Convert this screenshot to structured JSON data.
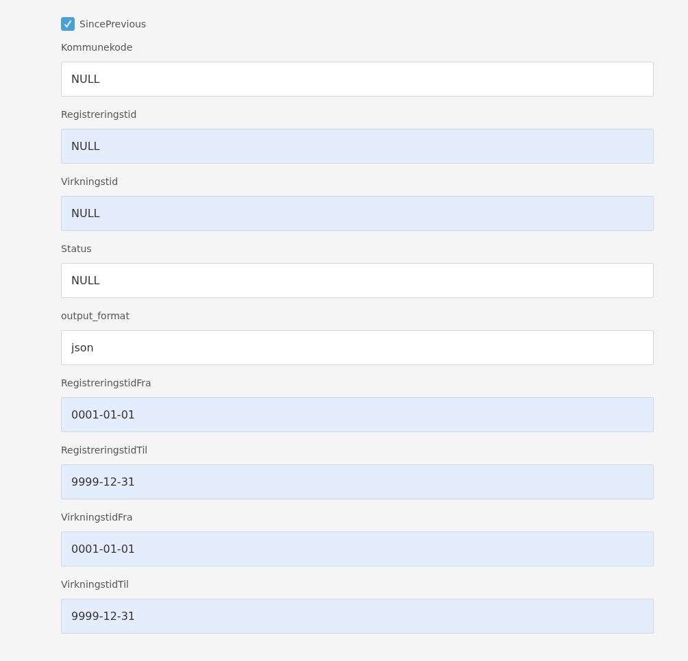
{
  "checkbox": {
    "label": "SincePrevious",
    "checked": true
  },
  "fields": [
    {
      "label": "Kommunekode",
      "value": "NULL",
      "autofilled": false
    },
    {
      "label": "Registreringstid",
      "value": "NULL",
      "autofilled": true
    },
    {
      "label": "Virkningstid",
      "value": "NULL",
      "autofilled": true
    },
    {
      "label": "Status",
      "value": "NULL",
      "autofilled": false
    },
    {
      "label": "output_format",
      "value": "json",
      "autofilled": false
    },
    {
      "label": "RegistreringstidFra",
      "value": "0001-01-01",
      "autofilled": true
    },
    {
      "label": "RegistreringstidTil",
      "value": "9999-12-31",
      "autofilled": true
    },
    {
      "label": "VirkningstidFra",
      "value": "0001-01-01",
      "autofilled": true
    },
    {
      "label": "VirkningstidTil",
      "value": "9999-12-31",
      "autofilled": true
    }
  ]
}
